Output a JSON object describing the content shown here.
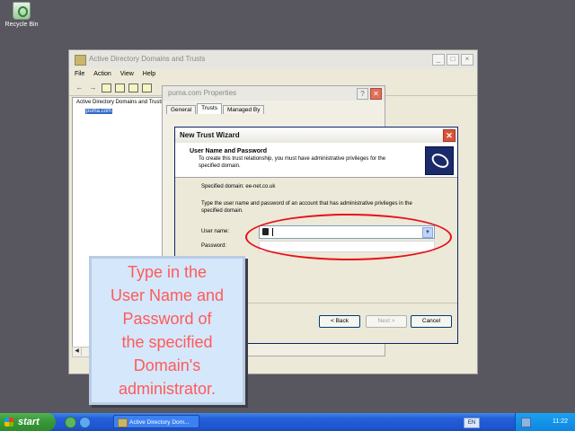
{
  "desktop": {
    "recycle_bin_label": "Recycle Bin"
  },
  "main_window": {
    "title": "Active Directory Domains and Trusts",
    "menu": [
      "File",
      "Action",
      "View",
      "Help"
    ],
    "tree": {
      "root": "Active Directory Domains and Trusts",
      "child": "puma.com"
    }
  },
  "properties_window": {
    "title": "puma.com Properties",
    "help_glyph": "?",
    "close_glyph": "✕",
    "tabs": [
      "General",
      "Trusts",
      "Managed By"
    ],
    "active_tab": "Trusts"
  },
  "wizard": {
    "title": "New Trust Wizard",
    "close_glyph": "✕",
    "header_title": "User Name and Password",
    "header_desc": "To create this trust relationship, you must have administrative privileges for the specified domain.",
    "specified_domain": "Specified domain: ee-net.co.uk",
    "instruction": "Type the user name and password of an account that has administrative privileges in the specified domain.",
    "user_name_label": "User name:",
    "user_name_value": "",
    "password_label": "Password:",
    "password_value": "",
    "back_label": "< Back",
    "next_label": "Next >",
    "cancel_label": "Cancel"
  },
  "callout": {
    "text": "Type in the\nUser Name and\nPassword of\nthe specified\nDomain's\nadministrator."
  },
  "taskbar": {
    "start_label": "start",
    "task_item": "Active Directory Dom...",
    "language": "EN",
    "clock": "11:22"
  },
  "colors": {
    "desktop": "#58565f",
    "highlight_ring": "#e8101a",
    "callout_text": "#ff5a5a",
    "callout_bg": "#d5e7fb"
  }
}
